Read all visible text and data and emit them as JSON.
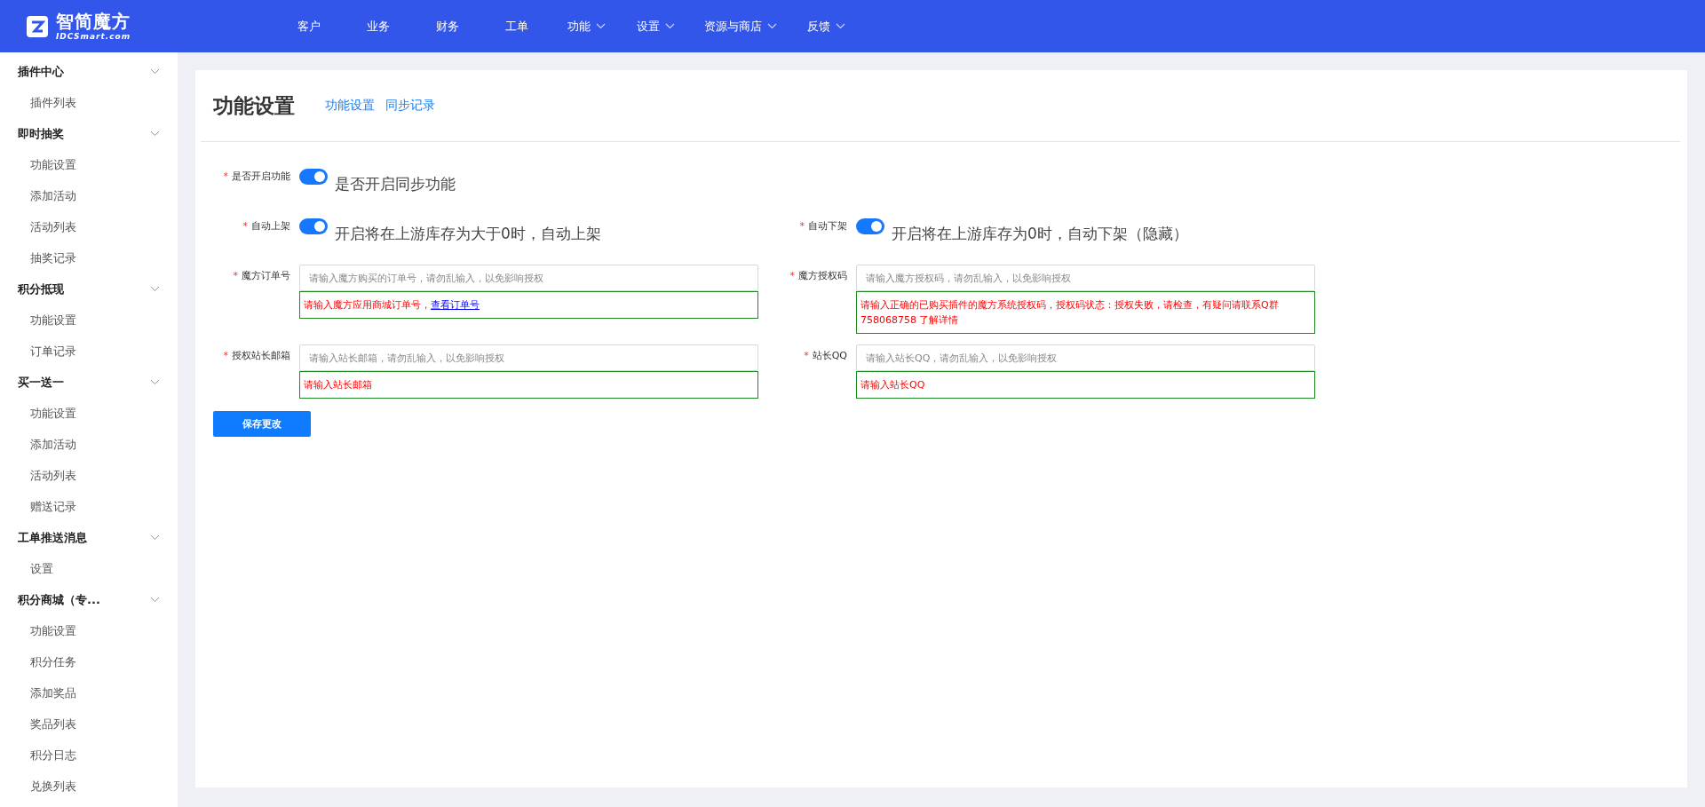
{
  "header": {
    "logo": {
      "title": "智简魔方",
      "subtitle": "IDCSmart.com"
    },
    "nav": [
      {
        "label": "客户",
        "dropdown": false
      },
      {
        "label": "业务",
        "dropdown": false
      },
      {
        "label": "财务",
        "dropdown": false
      },
      {
        "label": "工单",
        "dropdown": false
      },
      {
        "label": "功能",
        "dropdown": true
      },
      {
        "label": "设置",
        "dropdown": true
      },
      {
        "label": "资源与商店",
        "dropdown": true
      },
      {
        "label": "反馈",
        "dropdown": true
      }
    ]
  },
  "sidebar": {
    "groups": [
      {
        "label": "插件中心",
        "expanded": true,
        "children": [
          {
            "label": "插件列表"
          }
        ]
      },
      {
        "label": "即时抽奖",
        "expanded": true,
        "children": [
          {
            "label": "功能设置"
          },
          {
            "label": "添加活动"
          },
          {
            "label": "活动列表"
          },
          {
            "label": "抽奖记录"
          }
        ]
      },
      {
        "label": "积分抵现",
        "expanded": true,
        "children": [
          {
            "label": "功能设置"
          },
          {
            "label": "订单记录"
          }
        ]
      },
      {
        "label": "买一送一",
        "expanded": true,
        "children": [
          {
            "label": "功能设置"
          },
          {
            "label": "添加活动"
          },
          {
            "label": "活动列表"
          },
          {
            "label": "赠送记录"
          }
        ]
      },
      {
        "label": "工单推送消息",
        "expanded": true,
        "children": [
          {
            "label": "设置"
          }
        ]
      },
      {
        "label": "积分商城（专...",
        "expanded": true,
        "children": [
          {
            "label": "功能设置"
          },
          {
            "label": "积分任务"
          },
          {
            "label": "添加奖品"
          },
          {
            "label": "奖品列表"
          },
          {
            "label": "积分日志"
          },
          {
            "label": "兑换列表"
          }
        ]
      }
    ]
  },
  "card": {
    "title": "功能设置",
    "links": [
      "功能设置",
      "同步记录"
    ],
    "rows": [
      [
        {
          "kind": "toggle",
          "mark": "*",
          "label": "是否开启功能",
          "on": true,
          "description": "是否开启同步功能"
        }
      ],
      [
        {
          "kind": "toggle",
          "mark": "*",
          "label": "自动上架",
          "on": true,
          "description": "开启将在上游库存为大于0时，自动上架"
        },
        {
          "kind": "toggle",
          "mark": "*",
          "label": "自动下架",
          "on": true,
          "description": "开启将在上游库存为0时，自动下架（隐藏）"
        }
      ],
      [
        {
          "kind": "input",
          "mark": "*",
          "label": "魔方订单号",
          "placeholder": "请输入魔方购买的订单号，请勿乱输入，以免影响授权",
          "hint": "请输入魔方应用商城订单号，",
          "hint_link": "查看订单号"
        },
        {
          "kind": "input",
          "mark": "*",
          "label": "魔方授权码",
          "placeholder": "请输入魔方授权码，请勿乱输入，以免影响授权",
          "hint": "请输入正确的已购买插件的魔方系统授权码，授权码状态：授权失败，请检查，有疑问请联系Q群758068758 了解详情"
        }
      ],
      [
        {
          "kind": "input",
          "mark": "*",
          "label": "授权站长邮箱",
          "placeholder": "请输入站长邮箱，请勿乱输入，以免影响授权",
          "hint": "请输入站长邮箱"
        },
        {
          "kind": "input",
          "mark": "*",
          "label": "站长QQ",
          "placeholder": "请输入站长QQ，请勿乱输入，以免影响授权",
          "hint": "请输入站长QQ"
        }
      ]
    ],
    "save_button": "保存更改"
  }
}
